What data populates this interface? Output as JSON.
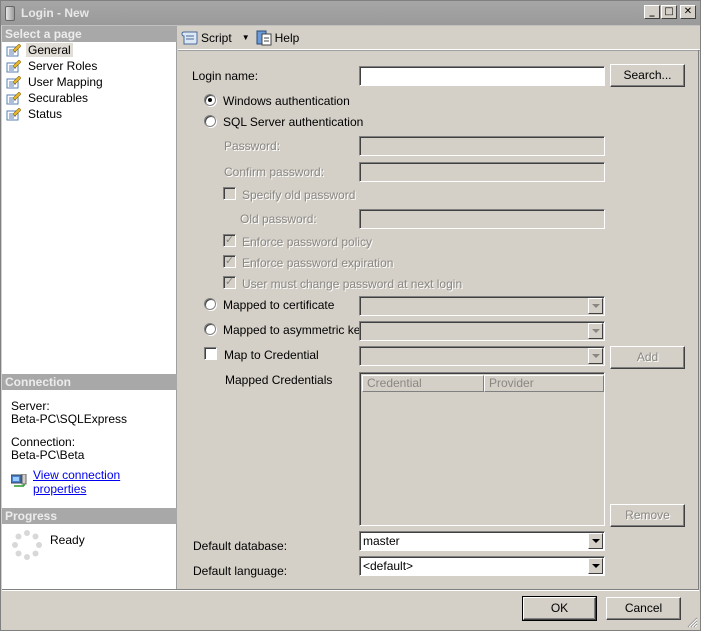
{
  "window": {
    "title": "Login - New",
    "controls": [
      "minimize",
      "maximize",
      "close"
    ]
  },
  "sidebar": {
    "select_page_header": "Select a page",
    "pages": [
      {
        "label": "General",
        "icon": "page-properties-icon",
        "selected": true
      },
      {
        "label": "Server Roles",
        "icon": "page-properties-icon",
        "selected": false
      },
      {
        "label": "User Mapping",
        "icon": "page-properties-icon",
        "selected": false
      },
      {
        "label": "Securables",
        "icon": "page-properties-icon",
        "selected": false
      },
      {
        "label": "Status",
        "icon": "page-properties-icon",
        "selected": false
      }
    ],
    "connection_header": "Connection",
    "server_label": "Server:",
    "server_value": "Beta-PC\\SQLExpress",
    "connection_label": "Connection:",
    "connection_value": "Beta-PC\\Beta",
    "view_connection_link": "View connection properties",
    "progress_header": "Progress",
    "progress_status": "Ready"
  },
  "toolbar": {
    "script_label": "Script",
    "help_label": "Help"
  },
  "form": {
    "login_name_label": "Login name:",
    "login_name_value": "",
    "search_button": "Search...",
    "windows_auth_label": "Windows authentication",
    "windows_auth_checked": true,
    "sql_auth_label": "SQL Server authentication",
    "sql_auth_checked": false,
    "password_label": "Password:",
    "confirm_password_label": "Confirm password:",
    "specify_old_password_label": "Specify old password",
    "specify_old_password_checked": false,
    "old_password_label": "Old password:",
    "enforce_policy_label": "Enforce password policy",
    "enforce_policy_checked": true,
    "enforce_expiration_label": "Enforce password expiration",
    "enforce_expiration_checked": true,
    "must_change_label": "User must change password at next login",
    "must_change_checked": true,
    "mapped_certificate_label": "Mapped to certificate",
    "mapped_asym_key_label": "Mapped to asymmetric key",
    "map_credential_label": "Map to Credential",
    "map_credential_checked": false,
    "add_button": "Add",
    "mapped_credentials_label": "Mapped Credentials",
    "credentials_columns": [
      "Credential",
      "Provider"
    ],
    "remove_button": "Remove",
    "default_database_label": "Default database:",
    "default_database_value": "master",
    "default_language_label": "Default language:",
    "default_language_value": "<default>"
  },
  "footer": {
    "ok_button": "OK",
    "cancel_button": "Cancel"
  }
}
